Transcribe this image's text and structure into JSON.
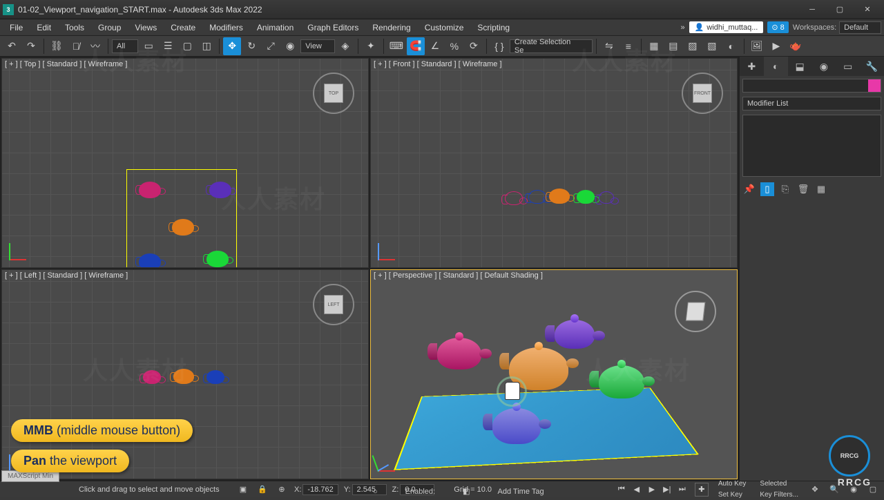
{
  "title": "01-02_Viewport_navigation_START.max - Autodesk 3ds Max 2022",
  "menu": [
    "File",
    "Edit",
    "Tools",
    "Group",
    "Views",
    "Create",
    "Modifiers",
    "Animation",
    "Graph Editors",
    "Rendering",
    "Customize",
    "Scripting"
  ],
  "user": "widhi_muttaq...",
  "user_count": "8",
  "workspace_label": "Workspaces:",
  "workspace": "Default",
  "toolbar": {
    "filter": "All",
    "view": "View",
    "sel_set": "Create Selection Se"
  },
  "viewports": {
    "top": "[ + ] [ Top ] [ Standard ] [ Wireframe ]",
    "front": "[ + ] [ Front ] [ Standard ] [ Wireframe ]",
    "left": "[ + ] [ Left ] [ Standard ] [ Wireframe ]",
    "persp": "[ + ] [ Perspective ] [ Standard ] [ Default Shading ]",
    "cube_top": "TOP",
    "cube_front": "FRONT",
    "cube_left": "LEFT"
  },
  "right_panel": {
    "modifier_list": "Modifier List"
  },
  "status": {
    "prompt": "Click and drag to select and move objects",
    "x_label": "X:",
    "x": "-18.762",
    "y_label": "Y:",
    "y": "2.545",
    "z_label": "Z:",
    "z": "0.0",
    "grid": "Grid = 10.0",
    "enabled": "Enabled:",
    "add_time_tag": "Add Time Tag",
    "autokey": "Auto Key",
    "setkey": "Set Key",
    "selected": "Selected",
    "keyfilters": "Key Filters..."
  },
  "hints": {
    "mmb_bold": "MMB",
    "mmb_rest": " (middle mouse button)",
    "pan_bold": "Pan",
    "pan_rest": " the viewport"
  },
  "maxscript": "MAXScript Min",
  "watermark": "人人素材",
  "rrcg": "RRCG"
}
